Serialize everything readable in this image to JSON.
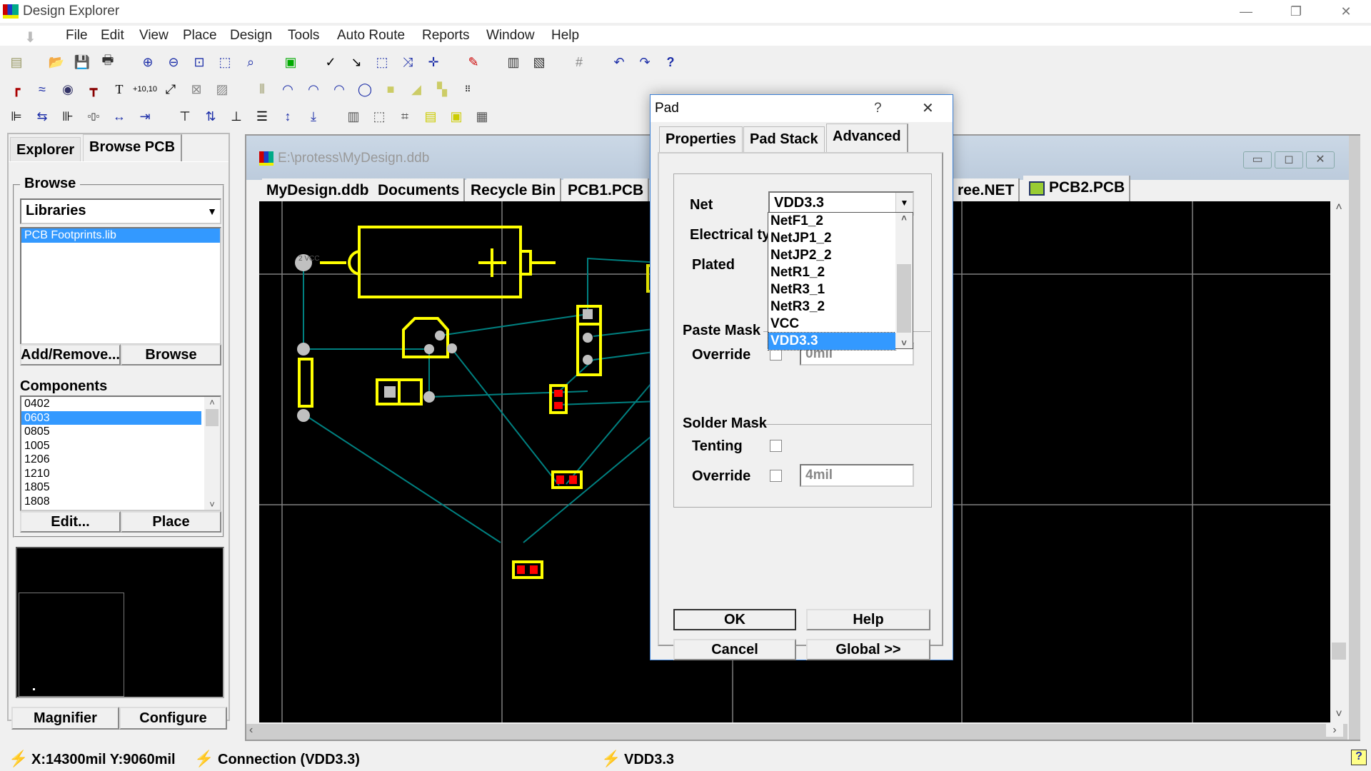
{
  "app": {
    "title": "Design Explorer"
  },
  "window_controls": {
    "minimize": "—",
    "restore": "❐",
    "close": "✕"
  },
  "menu": [
    "File",
    "Edit",
    "View",
    "Place",
    "Design",
    "Tools",
    "Auto Route",
    "Reports",
    "Window",
    "Help"
  ],
  "toolbar": {
    "row1": [
      "design-manager-icon",
      "open-icon",
      "save-icon",
      "print-icon",
      "zoom-in-icon",
      "zoom-out-icon",
      "fit-document-icon",
      "zoom-area-icon",
      "zoom-selected-icon",
      "pcb-3d-icon",
      "cross-probe-icon",
      "select-icon",
      "select-area-icon",
      "deselect-icon",
      "move-icon",
      "rubber-icon",
      "browse-library-icon",
      "add-library-icon",
      "grid-icon",
      "undo-icon",
      "redo-icon",
      "help-icon"
    ],
    "row2": [
      "interactive-route-icon",
      "place-line-icon",
      "place-via-icon",
      "place-string-pad-icon",
      "text-icon",
      "coordinate-icon",
      "dimension-icon",
      "keepout-icon",
      "polygon-plane-icon",
      "room-icon",
      "arc-center-icon",
      "arc-edge-icon",
      "arc-any-icon",
      "circle-icon",
      "fill-icon",
      "polygon-icon",
      "split-plane-icon",
      "array-paste-icon"
    ],
    "row3": [
      "align-left-icon",
      "align-hcenter-icon",
      "align-right-icon",
      "distribute-h-icon",
      "increase-h-spacing-icon",
      "decrease-h-spacing-icon",
      "align-top-icon",
      "align-vcenter-icon",
      "align-bottom-icon",
      "distribute-v-icon",
      "increase-v-spacing-icon",
      "decrease-v-spacing-icon",
      "arrange-inside-room-icon",
      "arrange-in-rect-icon",
      "move-to-grid-icon",
      "move-to-room-icon",
      "component-room-icon",
      "report-icon"
    ]
  },
  "left_panel": {
    "tabs": [
      {
        "label": "Explorer",
        "active": false
      },
      {
        "label": "Browse PCB",
        "active": true
      }
    ],
    "browse": {
      "group_label": "Browse",
      "select_value": "Libraries",
      "libraries": [
        {
          "label": "PCB Footprints.lib",
          "selected": true
        }
      ],
      "add_remove_label": "Add/Remove...",
      "browse_label": "Browse"
    },
    "components": {
      "label": "Components",
      "items": [
        {
          "label": "0402",
          "selected": false
        },
        {
          "label": "0603",
          "selected": true
        },
        {
          "label": "0805",
          "selected": false
        },
        {
          "label": "1005",
          "selected": false
        },
        {
          "label": "1206",
          "selected": false
        },
        {
          "label": "1210",
          "selected": false
        },
        {
          "label": "1805",
          "selected": false
        },
        {
          "label": "1808",
          "selected": false
        }
      ],
      "edit_label": "Edit...",
      "place_label": "Place"
    },
    "magnifier_label": "Magnifier",
    "configure_label": "Configure"
  },
  "document": {
    "path": "E:\\protess\\MyDesign.ddb",
    "tabs": [
      {
        "label": "MyDesign.ddb"
      },
      {
        "label": "Documents"
      },
      {
        "label": "Recycle Bin"
      },
      {
        "label": "PCB1.PCB"
      },
      {
        "label": "ree.NET"
      },
      {
        "label": "PCB2.PCB",
        "active": true
      }
    ],
    "mdi_controls": {
      "minimize": "▭",
      "restore": "◻",
      "close": "✕"
    }
  },
  "dialog": {
    "title": "Pad",
    "help": "?",
    "close": "✕",
    "tabs": [
      {
        "label": "Properties",
        "active": false
      },
      {
        "label": "Pad Stack",
        "active": false
      },
      {
        "label": "Advanced",
        "active": true
      }
    ],
    "net_label": "Net",
    "net_value": "VDD3.3",
    "net_options": [
      {
        "label": "NetF1_2"
      },
      {
        "label": "NetJP1_2"
      },
      {
        "label": "NetJP2_2"
      },
      {
        "label": "NetR1_2"
      },
      {
        "label": "NetR3_1"
      },
      {
        "label": "NetR3_2"
      },
      {
        "label": "VCC"
      },
      {
        "label": "VDD3.3",
        "selected": true
      }
    ],
    "electrical_label": "Electrical ty",
    "plated_label": "Plated",
    "paste_mask_label": "Paste Mask",
    "paste_override_label": "Override",
    "paste_override_value": "0mil",
    "solder_mask_label": "Solder Mask",
    "tenting_label": "Tenting",
    "solder_override_label": "Override",
    "solder_override_value": "4mil",
    "tenting_checked": false,
    "solder_override_checked": false,
    "paste_override_checked": false,
    "ok_label": "OK",
    "help_label": "Help",
    "cancel_label": "Cancel",
    "global_label": "Global >>"
  },
  "status": {
    "coords": "X:14300mil Y:9060mil",
    "connection": "Connection (VDD3.3)",
    "net": "VDD3.3",
    "help_icon": "?"
  },
  "pcb_colors": {
    "silkscreen": "#ffff00",
    "pad_smd": "#ff0000",
    "ratsnest": "#008080",
    "via": "#c0c0c0",
    "grid": "#808080",
    "background": "#000000"
  },
  "pcb_silk_label": "2 VCC"
}
